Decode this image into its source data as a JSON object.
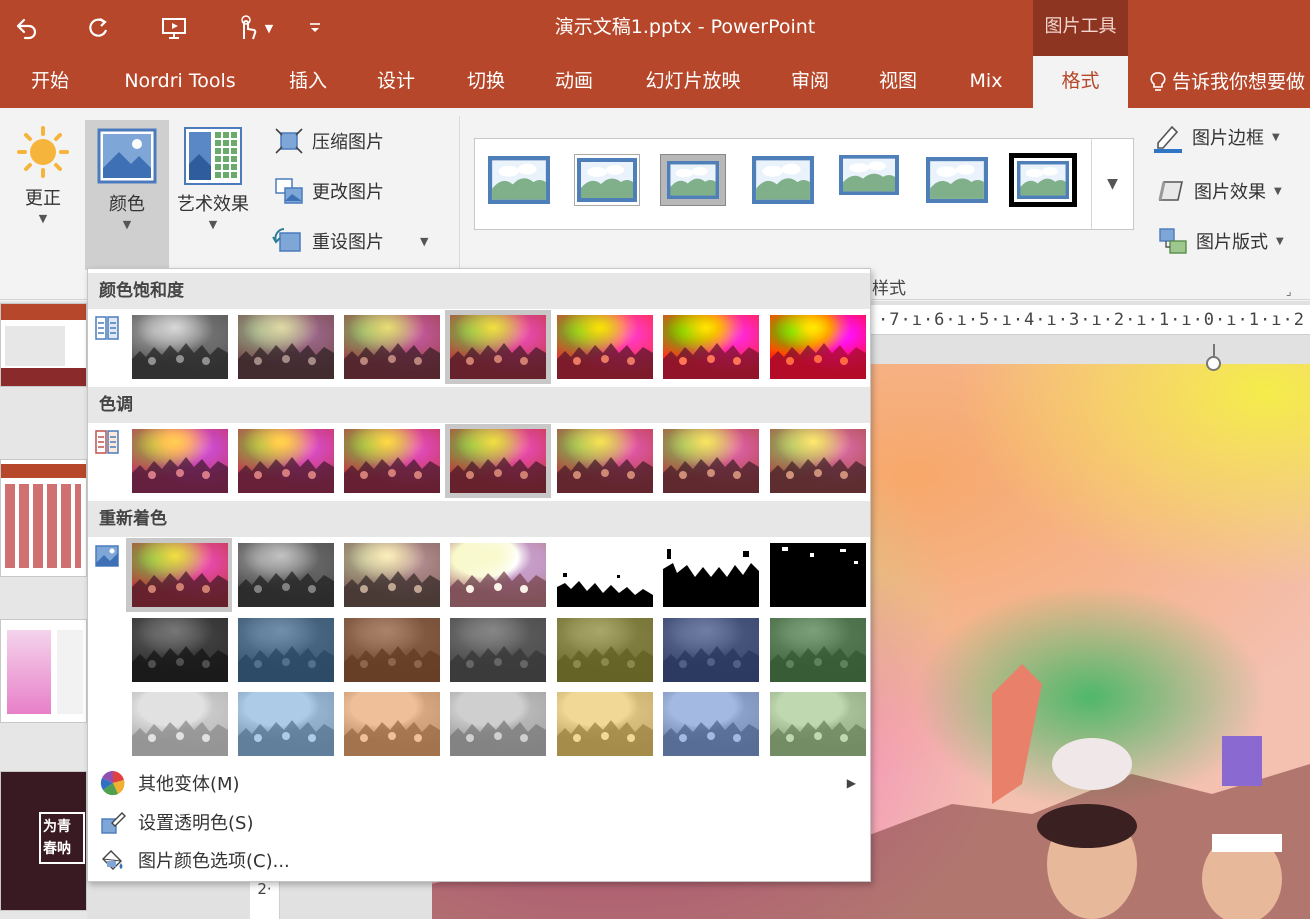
{
  "titlebar": {
    "title": "演示文稿1.pptx  -  PowerPoint",
    "context_tab": "图片工具",
    "bg_color": "#b7472a",
    "qat_icons": [
      "undo-icon",
      "redo-icon",
      "slideshow-from-start-icon",
      "touch-mode-icon",
      "customize-qat-icon"
    ]
  },
  "tabs": [
    {
      "label": "开始"
    },
    {
      "label": "Nordri Tools"
    },
    {
      "label": "插入"
    },
    {
      "label": "设计"
    },
    {
      "label": "切换"
    },
    {
      "label": "动画"
    },
    {
      "label": "幻灯片放映"
    },
    {
      "label": "审阅"
    },
    {
      "label": "视图"
    },
    {
      "label": "Mix"
    },
    {
      "label": "格式",
      "active": true
    }
  ],
  "tell_me": "告诉我你想要做",
  "ribbon": {
    "adjust": {
      "corrections": "更正",
      "color": "颜色",
      "artistic": "艺术效果",
      "compress": "压缩图片",
      "change": "更改图片",
      "reset": "重设图片"
    },
    "styles_group_label": "样式",
    "picture_border": "图片边框",
    "picture_effects": "图片效果",
    "picture_layout": "图片版式"
  },
  "ruler": {
    "horizontal": "·7·ı·6·ı·5·ı·4·ı·3·ı·2·ı·1·ı·0·ı·1·ı·2",
    "vertical": "2·"
  },
  "slide_thumb_text": "为青春呐喊",
  "color_menu": {
    "saturation_header": "颜色饱和度",
    "tone_header": "色调",
    "recolor_header": "重新着色",
    "more_variations": "其他变体(M)",
    "set_transparent": "设置透明色(S)",
    "color_options": "图片颜色选项(C)...",
    "recolor_tints": [
      "#000000",
      "#2b5c8a",
      "#8a4a20",
      "#444444",
      "#8a8620",
      "#2a4080",
      "#3e7a3a"
    ],
    "recolor_light_tints": [
      "#c8c8c8",
      "#6a9fd4",
      "#e08a45",
      "#a8a8a8",
      "#e8b840",
      "#5a80c8",
      "#8ab870"
    ]
  }
}
